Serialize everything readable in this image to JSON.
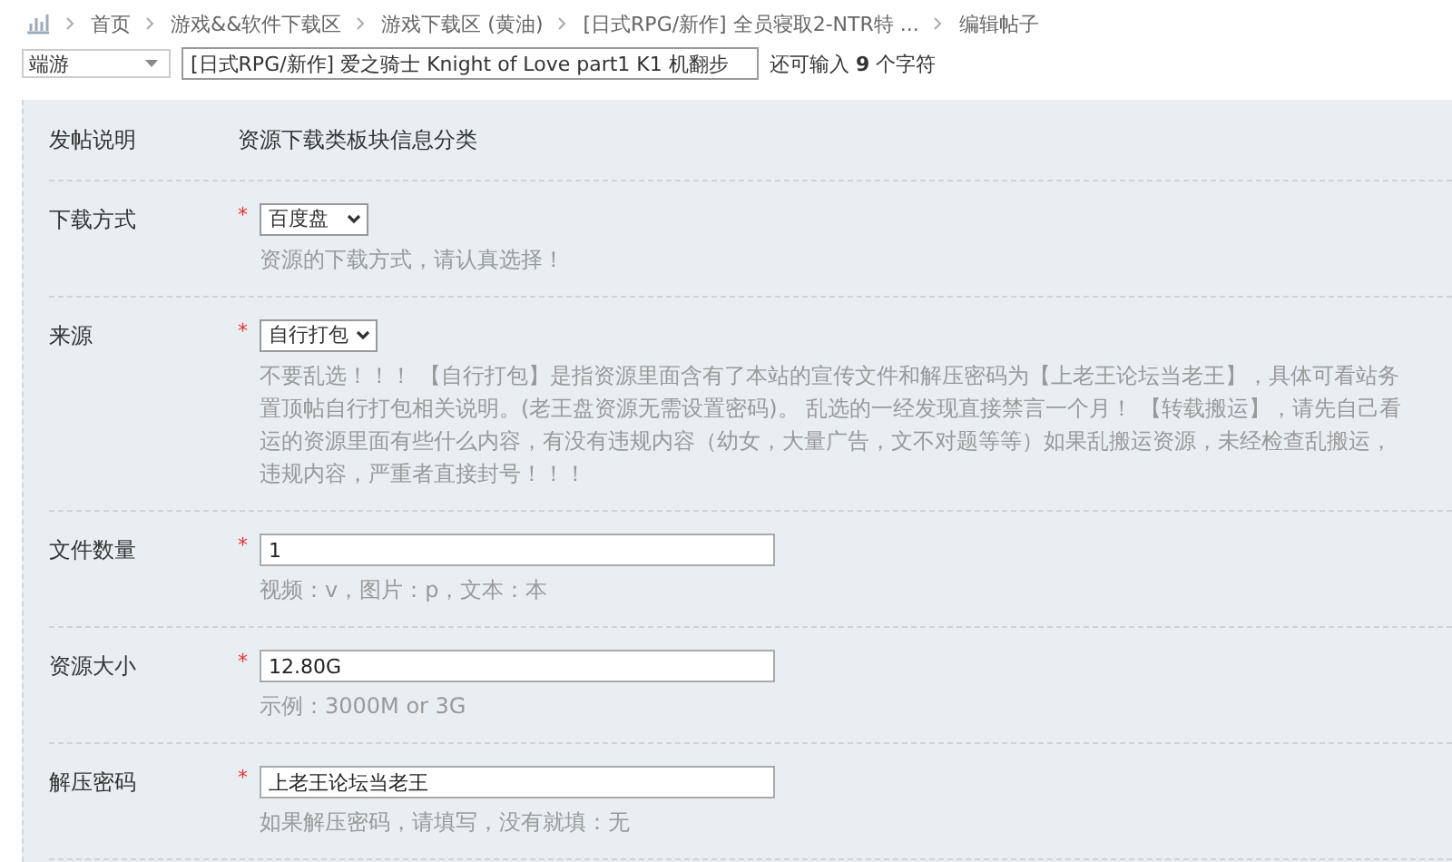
{
  "breadcrumb": [
    "首页",
    "游戏&&软件下载区",
    "游戏下载区 (黄油)",
    "[日式RPG/新作] 全员寝取2-NTR特 ...",
    "编辑帖子"
  ],
  "title_bar": {
    "type_select": "端游",
    "title_value": "[日式RPG/新作] 爱之骑士 Knight of Love part1 K1 机翻步",
    "remaining_prefix": "还可输入",
    "remaining_count": "9",
    "remaining_suffix": "个字符"
  },
  "form": {
    "rows": [
      {
        "kind": "info",
        "label": "发帖说明",
        "value": "资源下载类板块信息分类"
      },
      {
        "kind": "select",
        "label": "下载方式",
        "required_mark": "*",
        "value": "百度盘",
        "hint_lines": [
          "资源的下载方式，请认真选择！"
        ]
      },
      {
        "kind": "select",
        "label": "来源",
        "required_mark": "*",
        "value": "自行打包",
        "hint_lines": [
          "不要乱选！！！ 【自行打包】是指资源里面含有了本站的宣传文件和解压密码为【上老王论坛当老王】，具体可看站务",
          "置顶帖自行打包相关说明。(老王盘资源无需设置密码)。 乱选的一经发现直接禁言一个月！ 【转载搬运】，请先自己看",
          "运的资源里面有些什么内容，有没有违规内容（幼女，大量广告，文不对题等等）如果乱搬运资源，未经检查乱搬运，",
          "违规内容，严重者直接封号！！！"
        ]
      },
      {
        "kind": "text",
        "label": "文件数量",
        "required_mark": "*",
        "value": "1",
        "hint_lines": [
          "视频：v，图片：p，文本：本"
        ]
      },
      {
        "kind": "text",
        "label": "资源大小",
        "required_mark": "*",
        "value": "12.80G",
        "hint_lines": [
          "示例：3000M or 3G"
        ]
      },
      {
        "kind": "text",
        "label": "解压密码",
        "required_mark": "*",
        "value": "上老王论坛当老王",
        "hint_lines": [
          "如果解压密码，请填写，没有就填：无"
        ]
      }
    ]
  }
}
